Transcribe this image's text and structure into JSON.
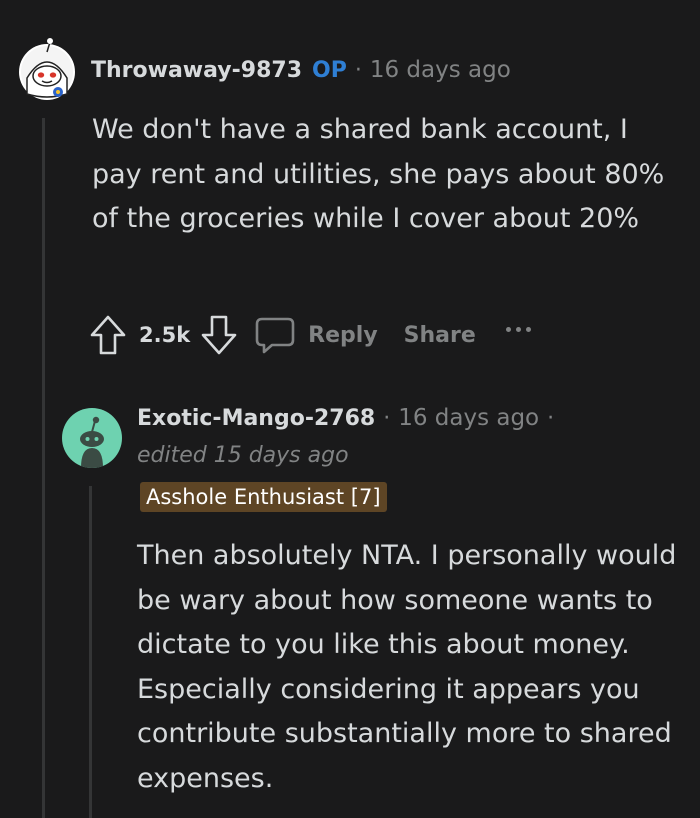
{
  "comments": [
    {
      "username": "Throwaway-9873",
      "op_badge": "OP",
      "separator": "·",
      "time": "16 days ago",
      "body": "We don't have a shared bank account, I pay rent and utilities, she pays about 80% of the groceries while I cover about 20%",
      "actions": {
        "score": "2.5k",
        "reply_label": "Reply",
        "share_label": "Share",
        "upvote_icon": "arrow-up-icon",
        "downvote_icon": "arrow-down-icon",
        "reply_icon": "speech-bubble-icon",
        "more_icon": "ellipsis-icon"
      }
    },
    {
      "username": "Exotic-Mango-2768",
      "separator": "·",
      "time": "16 days ago",
      "trailing_separator": "·",
      "edited": "edited 15 days ago",
      "flair": "Asshole Enthusiast [7]",
      "body": "Then absolutely NTA. I personally would be wary about how someone wants to dictate to you like this about money. Especially considering it appears you contribute substantially more to shared expenses."
    }
  ],
  "colors": {
    "background": "#1a1a1b",
    "text": "#d7dadc",
    "muted": "#818384",
    "op_badge": "#2f7fd4",
    "flair_background": "#5e4525",
    "avatar_mint": "#6ed2b0"
  }
}
